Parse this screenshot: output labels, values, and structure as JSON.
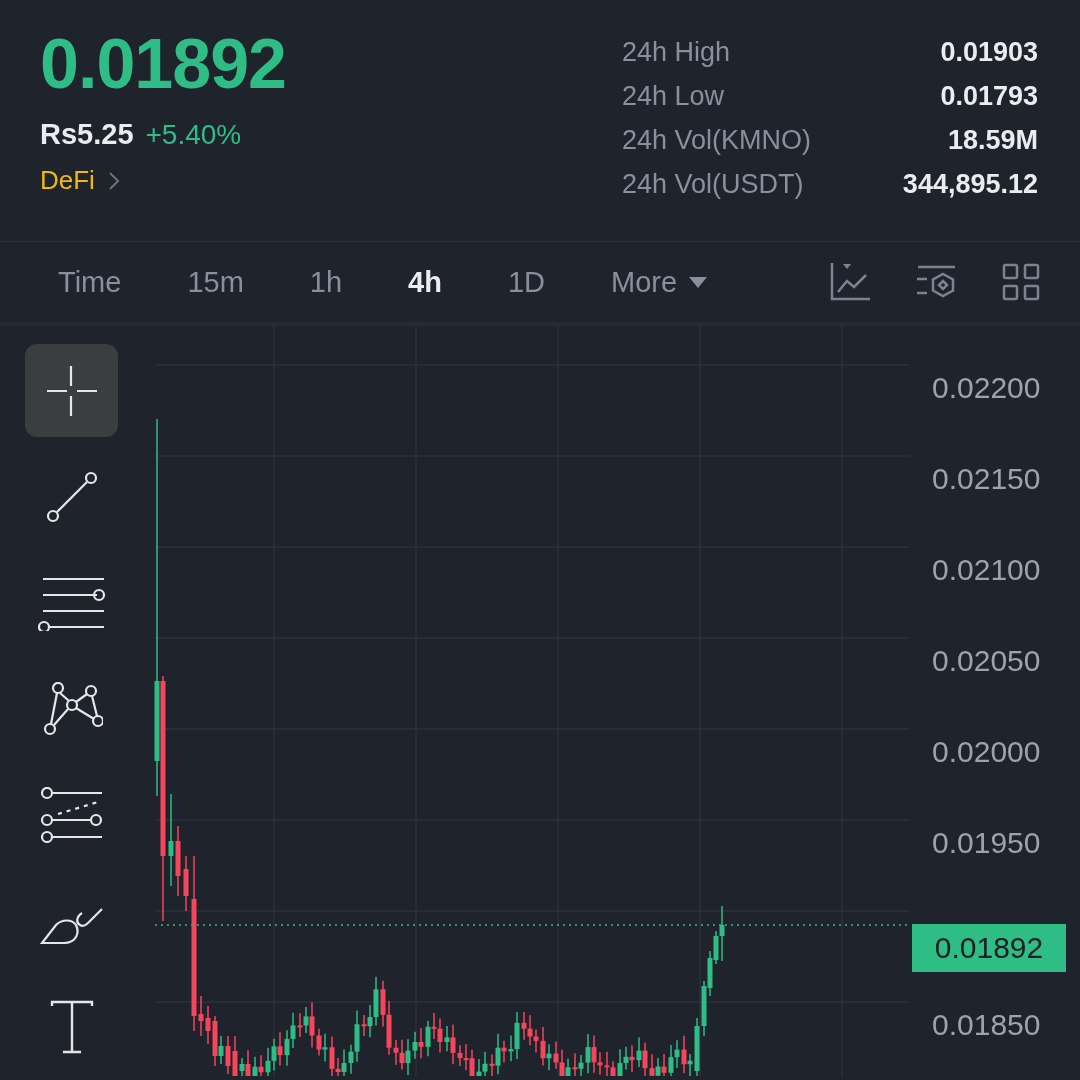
{
  "header": {
    "price": "0.01892",
    "fiat_price": "Rs5.25",
    "change": "+5.40%",
    "category": "DeFi"
  },
  "stats": [
    {
      "label": "24h High",
      "value": "0.01903"
    },
    {
      "label": "24h Low",
      "value": "0.01793"
    },
    {
      "label": "24h Vol(KMNO)",
      "value": "18.59M"
    },
    {
      "label": "24h Vol(USDT)",
      "value": "344,895.12"
    }
  ],
  "intervals": [
    {
      "label": "Time",
      "selected": false
    },
    {
      "label": "15m",
      "selected": false
    },
    {
      "label": "1h",
      "selected": false
    },
    {
      "label": "4h",
      "selected": true
    },
    {
      "label": "1D",
      "selected": false
    }
  ],
  "more_menu": {
    "label": "More"
  },
  "drawing_tools": [
    {
      "kind": "crosshair",
      "selected": true
    },
    {
      "kind": "trendline",
      "selected": false
    },
    {
      "kind": "parallel",
      "selected": false
    },
    {
      "kind": "pattern",
      "selected": false
    },
    {
      "kind": "fib",
      "selected": false
    },
    {
      "kind": "brush",
      "selected": false
    },
    {
      "kind": "text",
      "selected": false
    }
  ],
  "price_axis_upper": [
    "0.02200",
    "0.02150",
    "0.02100",
    "0.02050",
    "0.02000",
    "0.01950"
  ],
  "price_axis_lower": [
    "0.01850"
  ],
  "current_price_label": "0.01892"
}
